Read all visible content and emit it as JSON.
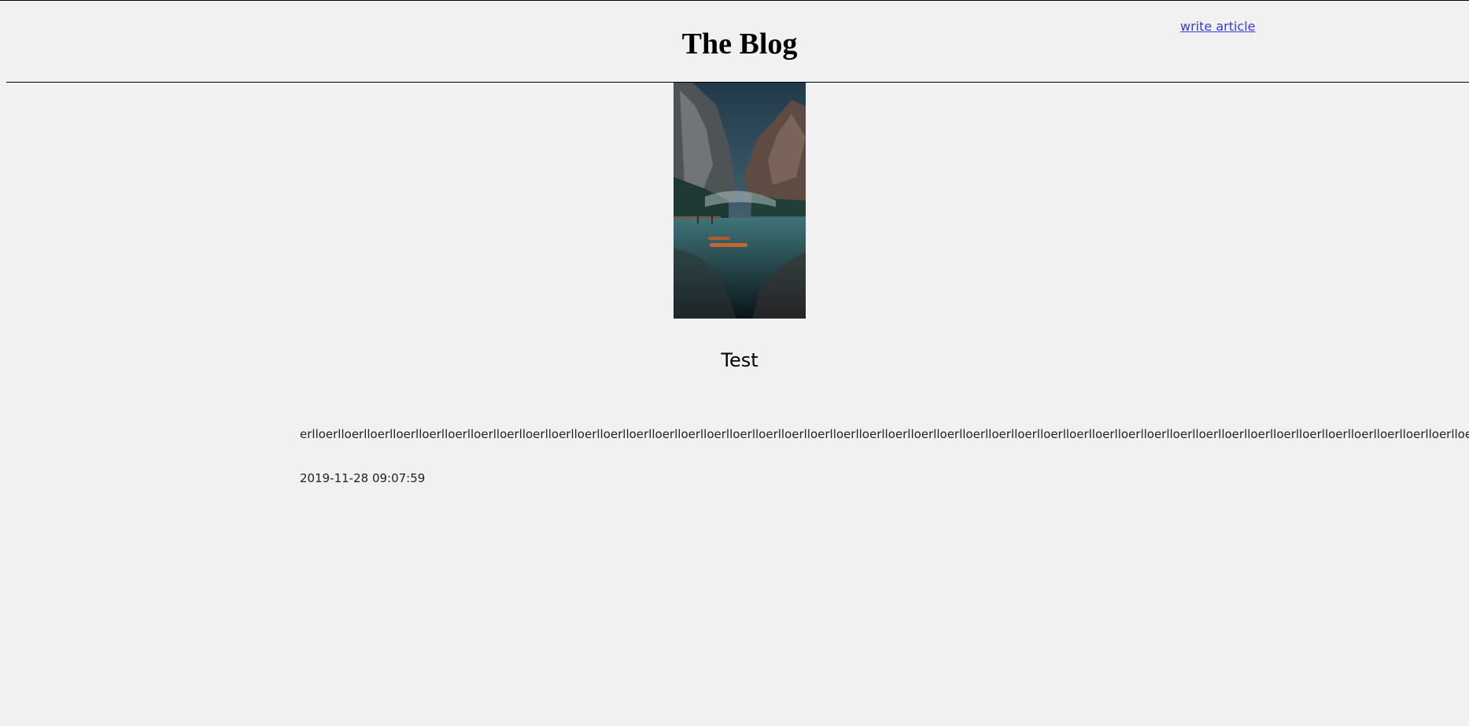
{
  "header": {
    "title": "The Blog",
    "write_link": "write article"
  },
  "article": {
    "image_icon": "landscape-photo",
    "title": "Test",
    "body": "erlloerlloerlloerlloerlloerlloerlloerlloerlloerlloerlloerlloerlloerlloerlloerlloerlloerlloerlloerlloerlloerlloerlloerlloerlloerlloerlloerlloerlloerlloerlloerlloerlloerlloerlloerlloerlloerlloerlloerlloerlloerlloerlloerlloerlloerlloerlloerlloerlloerlloerlloerlloerlloerlloerllo",
    "date": "2019-11-28 09:07:59"
  },
  "colors": {
    "background": "#f1f1f1",
    "link": "#3a3ad6",
    "text": "#222222"
  }
}
